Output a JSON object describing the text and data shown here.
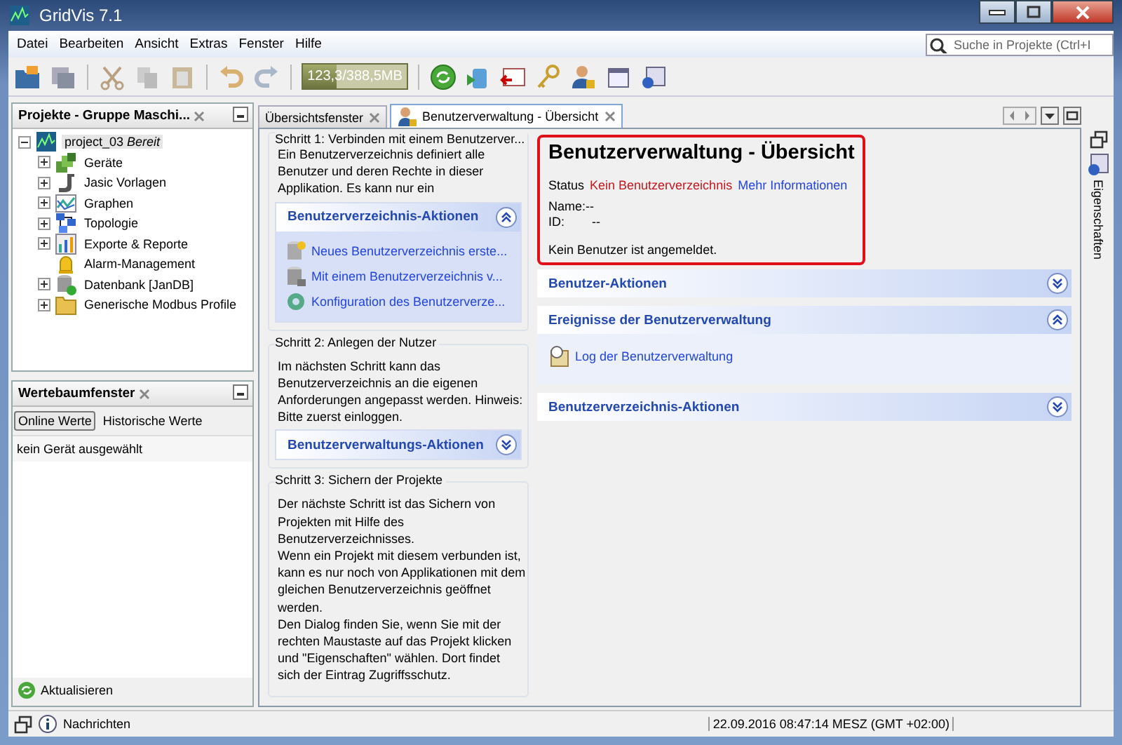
{
  "window": {
    "title": "GridVis 7.1"
  },
  "menu": [
    "Datei",
    "Bearbeiten",
    "Ansicht",
    "Extras",
    "Fenster",
    "Hilfe"
  ],
  "search": {
    "placeholder": "Suche in Projekte (Ctrl+I"
  },
  "toolbar": {
    "memory": "123,3/388,5MB",
    "level": 0.32
  },
  "projects_panel": {
    "title": "Projekte - Gruppe Maschi...",
    "tree": [
      {
        "label": "project_03",
        "status": "Bereit",
        "expanded": true,
        "selected": true,
        "children": [
          {
            "label": "Geräte",
            "expanded": false
          },
          {
            "label": "Jasic Vorlagen",
            "expanded": false
          },
          {
            "label": "Graphen",
            "expanded": false
          },
          {
            "label": "Topologie",
            "expanded": false
          },
          {
            "label": "Exporte & Reporte",
            "expanded": false
          },
          {
            "label": "Alarm-Management"
          },
          {
            "label": "Datenbank [JanDB]",
            "expanded": false
          },
          {
            "label": "Generische Modbus Profile",
            "expanded": false
          }
        ]
      }
    ]
  },
  "values_panel": {
    "title": "Wertebaumfenster",
    "tabs": [
      {
        "label": "Online Werte",
        "selected": true
      },
      {
        "label": "Historische Werte",
        "selected": false
      }
    ],
    "message": "kein Gerät ausgewählt",
    "refresh": "Aktualisieren"
  },
  "editor_tabs": [
    {
      "label": "Übersichtsfenster",
      "selected": false
    },
    {
      "label": "Benutzerverwaltung - Übersicht",
      "selected": true
    }
  ],
  "steps": [
    {
      "title": "Schritt 1: Verbinden mit einem Benutzerver...",
      "lines": [
        "Ein Benutzerverzeichnis definiert alle",
        "Benutzer und deren Rechte in dieser",
        "Applikation. Es kann nur ein"
      ],
      "actions": {
        "title": "Benutzerverzeichnis-Aktionen",
        "expanded": true,
        "items": [
          "Neues Benutzerverzeichnis erste...",
          "Mit einem Benutzerverzeichnis v...",
          "Konfiguration des Benutzerverze..."
        ]
      }
    },
    {
      "title": "Schritt 2: Anlegen der Nutzer",
      "lines": [
        "Im nächsten Schritt kann das",
        "Benutzerverzeichnis an die eigenen",
        "Anforderungen angepasst werden. Hinweis:",
        "Bitte zuerst einloggen."
      ],
      "actions": {
        "title": "Benutzerverwaltungs-Aktionen",
        "expanded": false
      }
    },
    {
      "title": "Schritt 3: Sichern der Projekte",
      "lines": [
        "Der nächste Schritt ist das Sichern von",
        "Projekten mit Hilfe des",
        "Benutzerverzeichnisses.",
        "Wenn ein Projekt mit diesem verbunden ist,",
        "kann es nur noch von Applikationen mit dem",
        "gleichen Benutzerverzeichnis geöffnet",
        "werden.",
        "Den Dialog finden Sie, wenn Sie mit der",
        "rechten Maustaste auf das Projekt klicken",
        "und \"Eigenschaften\" wählen. Dort findet",
        "sich der Eintrag Zugriffsschutz."
      ]
    }
  ],
  "overview": {
    "title": "Benutzerverwaltung - Übersicht",
    "status_label": "Status",
    "status_value": "Kein Benutzerverzeichnis",
    "more_link": "Mehr Informationen",
    "name_label": "Name:",
    "name_value": "--",
    "id_label": "ID:",
    "id_value": "--",
    "login_message": "Kein Benutzer ist angemeldet."
  },
  "sections": [
    {
      "title": "Benutzer-Aktionen",
      "expanded": false
    },
    {
      "title": "Ereignisse der Benutzerverwaltung",
      "expanded": true,
      "items": [
        "Log der Benutzerverwaltung"
      ]
    },
    {
      "title": "Benutzerverzeichnis-Aktionen",
      "expanded": false
    }
  ],
  "side_tab": "Eigenschaften",
  "status_bar": {
    "messages": "Nachrichten",
    "datetime": "22.09.2016 08:47:14 MESZ (GMT +02:00)"
  }
}
